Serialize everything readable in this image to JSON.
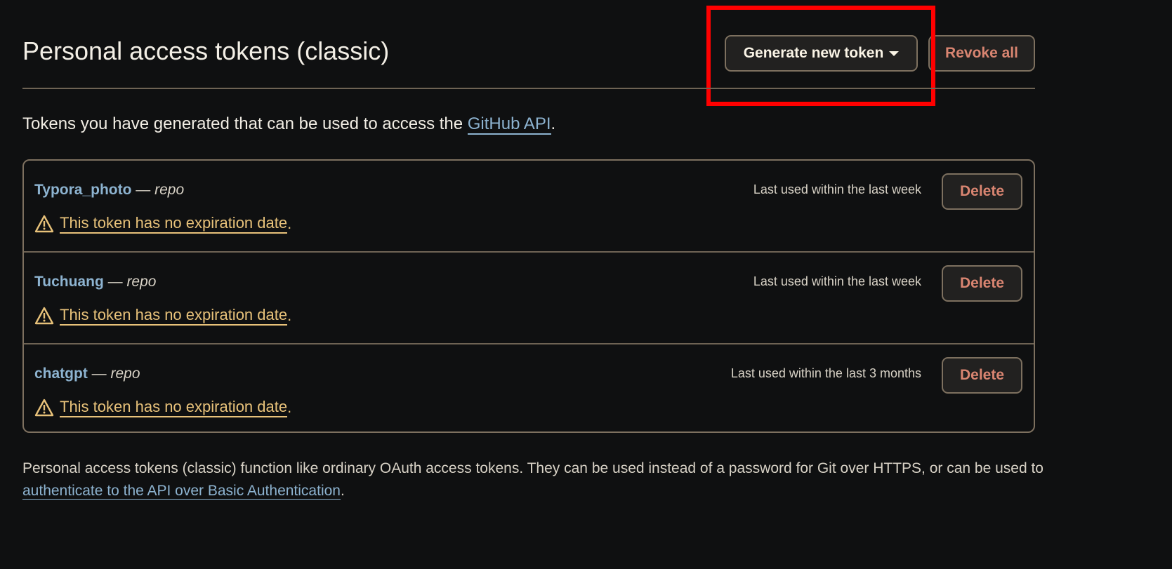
{
  "header": {
    "title": "Personal access tokens (classic)",
    "generate_label": "Generate new token",
    "revoke_all_label": "Revoke all"
  },
  "intro": {
    "text": "Tokens you have generated that can be used to access the ",
    "link": "GitHub API",
    "end": "."
  },
  "tokens": [
    {
      "name": "Typora_photo",
      "dash": " — ",
      "scope": "repo",
      "warning": "This token has no expiration date",
      "last_used": "Last used within the last week",
      "delete_label": "Delete"
    },
    {
      "name": "Tuchuang",
      "dash": " — ",
      "scope": "repo",
      "warning": "This token has no expiration date",
      "last_used": "Last used within the last week",
      "delete_label": "Delete"
    },
    {
      "name": "chatgpt",
      "dash": " — ",
      "scope": "repo",
      "warning": "This token has no expiration date",
      "last_used": "Last used within the last 3 months",
      "delete_label": "Delete"
    }
  ],
  "footer": {
    "text": "Personal access tokens (classic) function like ordinary OAuth access tokens. They can be used instead of a password for Git over HTTPS, or can be used to ",
    "link": "authenticate to the API over Basic Authentication",
    "end": "."
  },
  "colors": {
    "background": "#0f1011",
    "link": "#8db3d0",
    "warning": "#e8c27a",
    "danger": "#d98571",
    "highlight": "#ff0000"
  }
}
